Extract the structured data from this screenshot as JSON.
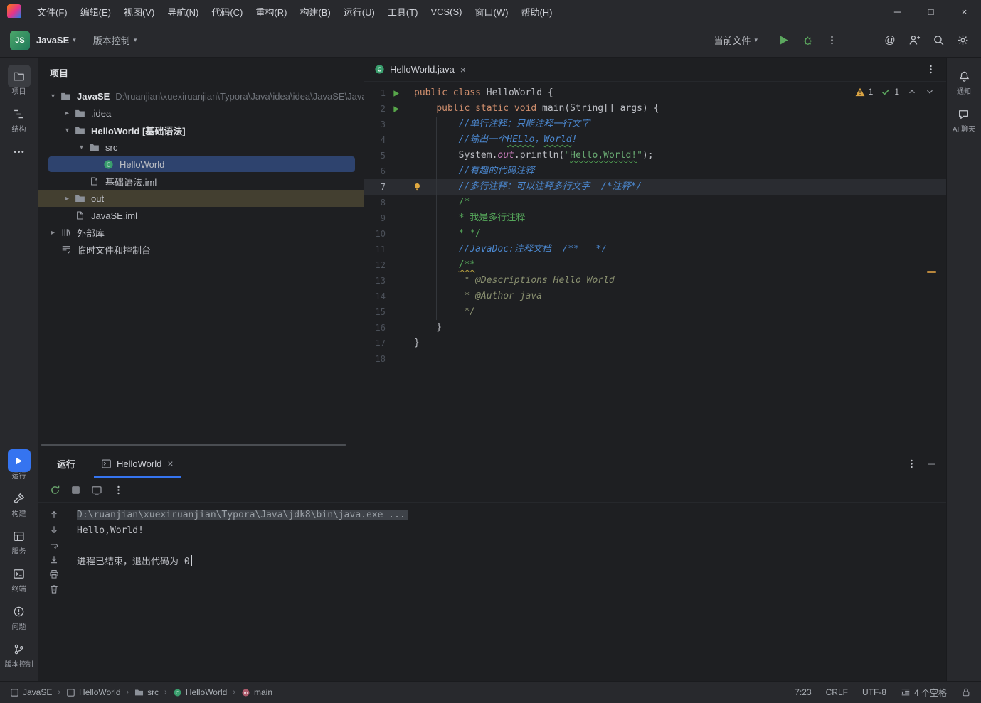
{
  "window": {
    "controls": {
      "minimize": "─",
      "maximize": "□",
      "close": "×"
    }
  },
  "menu_bar": {
    "items": [
      "文件(F)",
      "编辑(E)",
      "视图(V)",
      "导航(N)",
      "代码(C)",
      "重构(R)",
      "构建(B)",
      "运行(U)",
      "工具(T)",
      "VCS(S)",
      "窗口(W)",
      "帮助(H)"
    ]
  },
  "toolbar": {
    "project_avatar_text": "JS",
    "project_name": "JavaSE",
    "vcs_widget": "版本控制",
    "run_config": "当前文件"
  },
  "left_strip": {
    "top": [
      {
        "id": "project",
        "label": "项目",
        "icon": "folder-line",
        "active": true
      },
      {
        "id": "structure",
        "label": "结构",
        "icon": "structure",
        "active": false
      },
      {
        "id": "more",
        "label": "",
        "icon": "more",
        "active": false
      }
    ],
    "bottom": [
      {
        "id": "run",
        "label": "运行",
        "icon": "play-white",
        "active": true
      },
      {
        "id": "build",
        "label": "构建",
        "icon": "hammer",
        "active": false
      },
      {
        "id": "services",
        "label": "服务",
        "icon": "services",
        "active": false
      },
      {
        "id": "terminal",
        "label": "终端",
        "icon": "terminal",
        "active": false
      },
      {
        "id": "problems",
        "label": "问题",
        "icon": "problems",
        "active": false
      },
      {
        "id": "vcs",
        "label": "版本控制",
        "icon": "branch",
        "active": false
      }
    ]
  },
  "right_strip": [
    {
      "id": "notifications",
      "label": "通知",
      "icon": "bell",
      "active": false
    },
    {
      "id": "ai-chat",
      "label": "AI 聊天",
      "icon": "chat",
      "active": false
    }
  ],
  "project_panel": {
    "title": "项目",
    "tree": [
      {
        "depth": 0,
        "chevron": "down",
        "icon": "folder",
        "label": "JavaSE",
        "bold": true,
        "path": "D:\\ruanjian\\xuexiruanjian\\Typora\\Java\\idea\\idea\\JavaSE\\JavaSE"
      },
      {
        "depth": 1,
        "chevron": "right",
        "icon": "folder",
        "label": ".idea"
      },
      {
        "depth": 1,
        "chevron": "down",
        "icon": "folder",
        "label": "HelloWorld [基础语法]",
        "bold": true
      },
      {
        "depth": 2,
        "chevron": "down",
        "icon": "folder",
        "label": "src"
      },
      {
        "depth": 3,
        "chevron": "none",
        "icon": "class",
        "label": "HelloWorld",
        "selected": true
      },
      {
        "depth": 2,
        "chevron": "none",
        "icon": "file",
        "label": "基础语法.iml"
      },
      {
        "depth": 1,
        "chevron": "right",
        "icon": "folder",
        "label": "out",
        "tinted": true
      },
      {
        "depth": 1,
        "chevron": "none",
        "icon": "file",
        "label": "JavaSE.iml"
      },
      {
        "depth": 0,
        "chevron": "right",
        "icon": "library",
        "label": "外部库"
      },
      {
        "depth": 0,
        "chevron": "none",
        "icon": "scratch",
        "label": "临时文件和控制台"
      }
    ]
  },
  "editor": {
    "tab_title": "HelloWorld.java",
    "inspections": {
      "warnings": "1",
      "passed": "1"
    },
    "lines": [
      {
        "num": "1",
        "run": true,
        "segs": [
          [
            "kw",
            "public class "
          ],
          [
            "plain",
            "HelloWorld {"
          ]
        ]
      },
      {
        "num": "2",
        "run": true,
        "segs": [
          [
            "plain",
            "    "
          ],
          [
            "kw",
            "public static void "
          ],
          [
            "plain",
            "main(String[] args) {"
          ]
        ]
      },
      {
        "num": "3",
        "segs": [
          [
            "cmt",
            "        //单行注释：只能注释一行文字"
          ]
        ]
      },
      {
        "num": "4",
        "segs": [
          [
            "cmt",
            "        //输出一个"
          ],
          [
            "cmt typo",
            "HELlo"
          ],
          [
            "cmt",
            "，"
          ],
          [
            "cmt typo",
            "World"
          ],
          [
            "cmt",
            "!"
          ]
        ]
      },
      {
        "num": "5",
        "segs": [
          [
            "plain",
            "        System."
          ],
          [
            "field",
            "out"
          ],
          [
            "plain",
            ".println("
          ],
          [
            "str",
            "\""
          ],
          [
            "str typo",
            "Hello,World!"
          ],
          [
            "str",
            "\""
          ],
          [
            "plain",
            ");"
          ]
        ]
      },
      {
        "num": "6",
        "segs": [
          [
            "cmt",
            "        //有趣的代码注释"
          ]
        ]
      },
      {
        "num": "7",
        "current": true,
        "bulb": true,
        "segs": [
          [
            "cmt",
            "        //多行注释：可以注释多行文字  /*注释*/"
          ]
        ]
      },
      {
        "num": "8",
        "segs": [
          [
            "block",
            "        /*"
          ]
        ]
      },
      {
        "num": "9",
        "segs": [
          [
            "block",
            "        * 我是多行注释"
          ]
        ]
      },
      {
        "num": "10",
        "segs": [
          [
            "block",
            "        * */"
          ]
        ]
      },
      {
        "num": "11",
        "segs": [
          [
            "cmt",
            "        //JavaDoc:注释文档  /**   */"
          ]
        ]
      },
      {
        "num": "12",
        "segs": [
          [
            "plain",
            "        "
          ],
          [
            "block warn",
            "/**"
          ]
        ]
      },
      {
        "num": "13",
        "segs": [
          [
            "doc",
            "         * @Descriptions Hello World"
          ]
        ]
      },
      {
        "num": "14",
        "segs": [
          [
            "doc",
            "         * @Author java"
          ]
        ]
      },
      {
        "num": "15",
        "segs": [
          [
            "doc",
            "         */"
          ]
        ]
      },
      {
        "num": "16",
        "segs": [
          [
            "plain",
            "    }"
          ]
        ]
      },
      {
        "num": "17",
        "segs": [
          [
            "plain",
            "}"
          ]
        ]
      },
      {
        "num": "18",
        "segs": []
      }
    ]
  },
  "run_panel": {
    "title": "运行",
    "tab_title": "HelloWorld",
    "console": [
      {
        "style": "path",
        "text": "D:\\ruanjian\\xuexiruanjian\\Typora\\Java\\jdk8\\bin\\java.exe ..."
      },
      {
        "style": "out",
        "text": "Hello,World!"
      },
      {
        "style": "out",
        "text": ""
      },
      {
        "style": "out",
        "text": "进程已结束，退出代码为 0",
        "caret": true
      }
    ]
  },
  "status_bar": {
    "breadcrumbs": [
      {
        "icon": "module",
        "label": "JavaSE"
      },
      {
        "icon": "module",
        "label": "HelloWorld"
      },
      {
        "icon": "folder-s",
        "label": "src"
      },
      {
        "icon": "class-s",
        "label": "HelloWorld"
      },
      {
        "icon": "method",
        "label": "main"
      }
    ],
    "caret_position": "7:23",
    "line_separator": "CRLF",
    "encoding": "UTF-8",
    "indent": "4 个空格"
  },
  "colors": {
    "accent": "#3574F0",
    "selection": "#2E436E",
    "run_green": "#5CA85F",
    "warning": "#D9A343"
  }
}
